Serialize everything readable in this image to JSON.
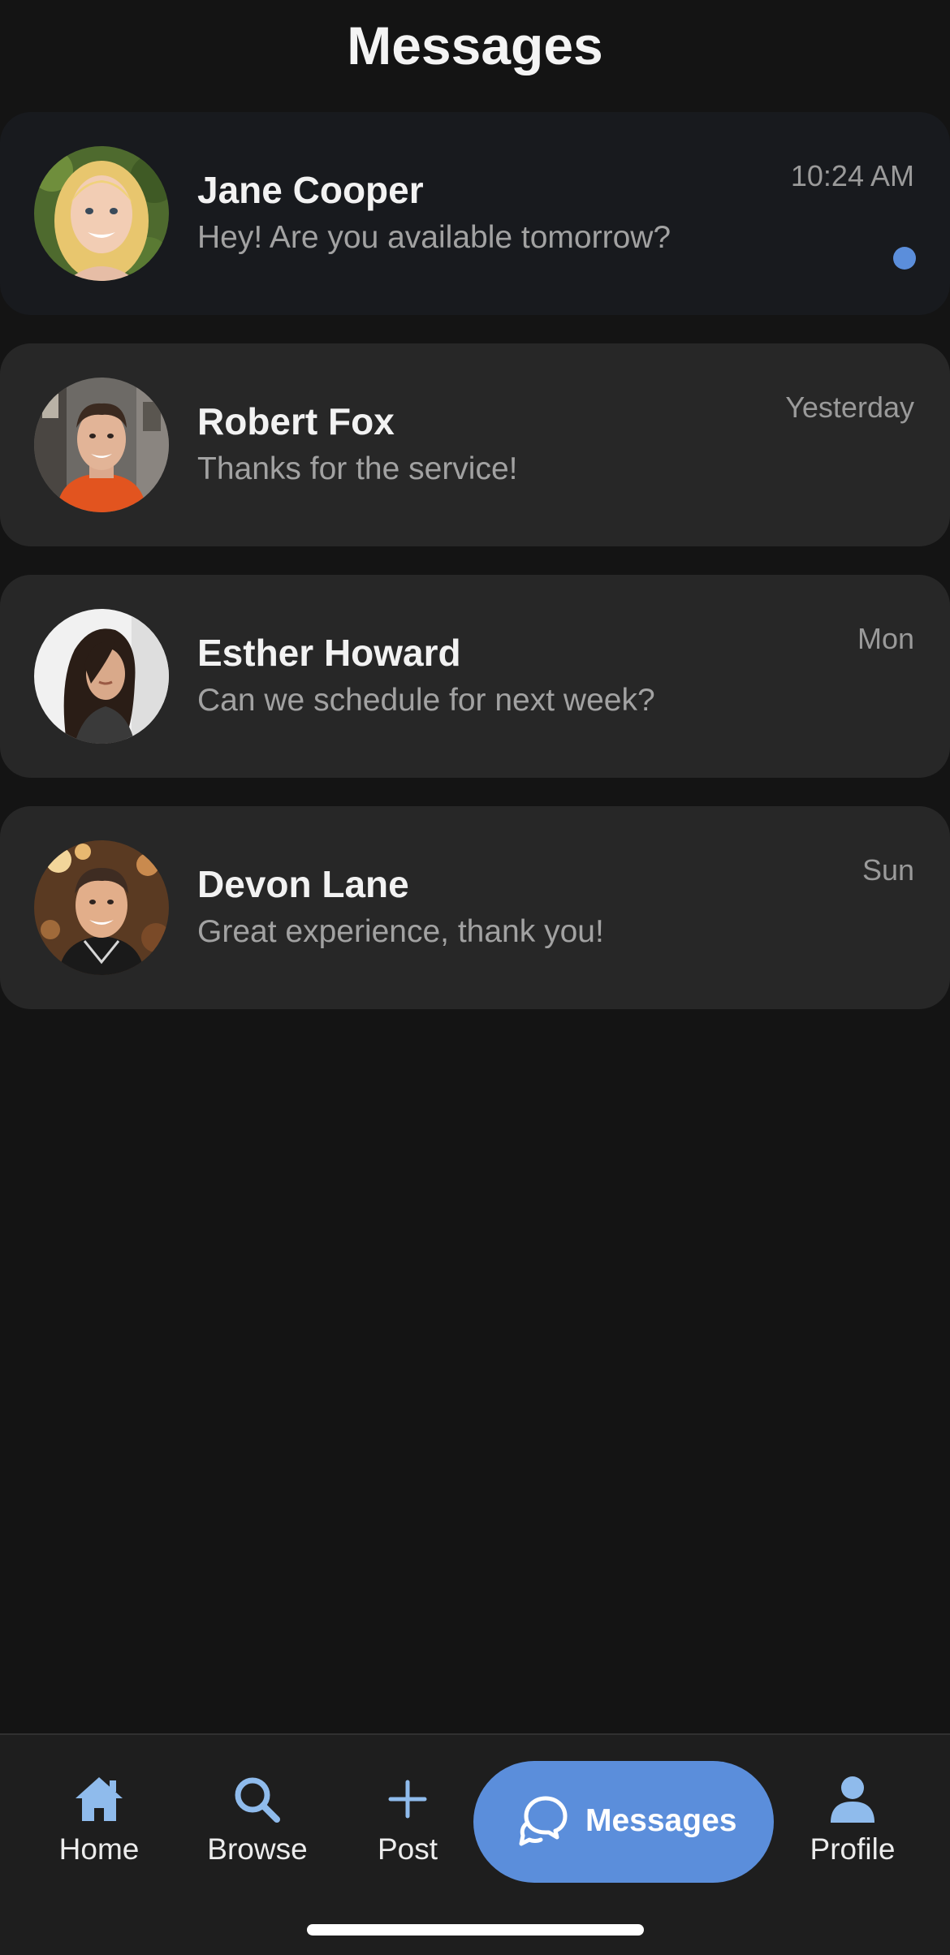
{
  "header": {
    "title": "Messages"
  },
  "conversations": [
    {
      "name": "Jane Cooper",
      "preview": "Hey! Are you available tomorrow?",
      "time": "10:24 AM",
      "unread": true
    },
    {
      "name": "Robert Fox",
      "preview": "Thanks for the service!",
      "time": "Yesterday",
      "unread": false
    },
    {
      "name": "Esther Howard",
      "preview": "Can we schedule for next week?",
      "time": "Mon",
      "unread": false
    },
    {
      "name": "Devon Lane",
      "preview": "Great experience, thank you!",
      "time": "Sun",
      "unread": false
    }
  ],
  "tab_bar": {
    "tabs": [
      {
        "label": "Home",
        "icon": "home-icon",
        "active": false
      },
      {
        "label": "Browse",
        "icon": "search-icon",
        "active": false
      },
      {
        "label": "Post",
        "icon": "plus-icon",
        "active": false
      },
      {
        "label": "Messages",
        "icon": "chat-bubbles-icon",
        "active": true
      },
      {
        "label": "Profile",
        "icon": "person-icon",
        "active": false
      }
    ]
  },
  "colors": {
    "accent": "#5b8edb",
    "background": "#141414",
    "card": "#272727",
    "card_unread": "#181a1e",
    "icon_inactive": "#8fbbec",
    "text_primary": "#f2f2f2",
    "text_secondary": "#a2a2a2"
  }
}
